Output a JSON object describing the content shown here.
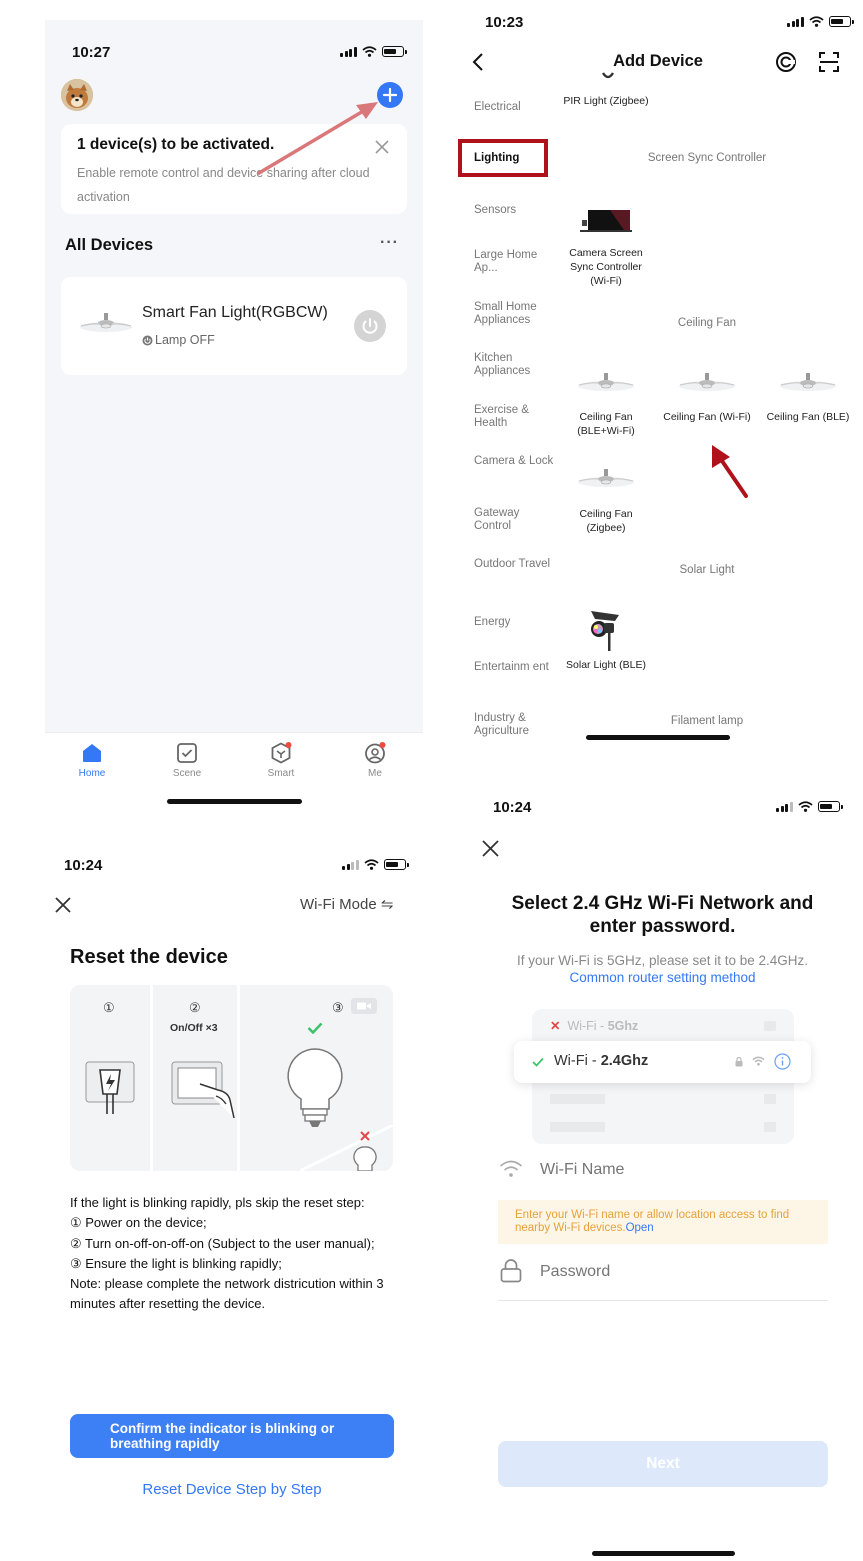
{
  "home": {
    "time": "10:27",
    "activation_title": "1 device(s) to be activated.",
    "activation_desc": "Enable remote control and device sharing after cloud activation",
    "all_devices": "All Devices",
    "more": "···",
    "device_name": "Smart Fan Light(RGBCW)",
    "device_status": "Lamp OFF",
    "tabs": [
      "Home",
      "Scene",
      "Smart",
      "Me"
    ]
  },
  "add_device": {
    "time": "10:23",
    "title": "Add Device",
    "categories": [
      "Electrical",
      "Lighting",
      "Sensors",
      "Large Home Ap...",
      "Small Home Appliances",
      "Kitchen Appliances",
      "Exercise & Health",
      "Camera & Lock",
      "Gateway Control",
      "Outdoor Travel",
      "Energy",
      "Entertainm ent",
      "Industry & Agriculture"
    ],
    "selected_category": "Lighting",
    "pir_light": "PIR Light (Zigbee)",
    "section_screen_sync": "Screen Sync Controller",
    "camera_sync": "Camera Screen Sync Controller (Wi-Fi)",
    "section_ceiling_fan": "Ceiling Fan",
    "fans": [
      "Ceiling Fan (BLE+Wi-Fi)",
      "Ceiling Fan (Wi-Fi)",
      "Ceiling Fan (BLE)",
      "Ceiling Fan (Zigbee)"
    ],
    "section_solar": "Solar Light",
    "solar_ble": "Solar Light (BLE)",
    "section_filament": "Filament lamp"
  },
  "reset": {
    "time": "10:24",
    "mode": "Wi-Fi Mode ⇋",
    "title": "Reset the device",
    "step_numbers": [
      "①",
      "②",
      "③"
    ],
    "step2_label": "On/Off ×3",
    "instructions": [
      "If the light is blinking rapidly, pls skip the reset step:",
      "① Power on the device;",
      "② Turn on-off-on-off-on (Subject to the user manual);",
      "③ Ensure the light is blinking rapidly;",
      "Note: please complete the network districution within 3 minutes after resetting the device."
    ],
    "confirm_button": "Confirm the indicator is blinking or breathing rapidly",
    "step_by_step": "Reset Device Step by Step"
  },
  "wifi": {
    "time": "10:24",
    "title": "Select 2.4 GHz Wi-Fi Network and enter password.",
    "desc": "If your Wi-Fi is 5GHz, please set it to be 2.4GHz.",
    "link": "Common router setting method",
    "wifi_5g_prefix": "Wi-Fi - ",
    "wifi_5g_band": "5Ghz",
    "wifi_24_prefix": "Wi-Fi - ",
    "wifi_24_band": "2.4Ghz",
    "name_placeholder": "Wi-Fi Name",
    "location_hint": "Enter your Wi-Fi name or allow location access to find nearby Wi-Fi devices.",
    "location_open": "Open",
    "password_placeholder": "Password",
    "next": "Next"
  },
  "colors": {
    "accent": "#3478f6",
    "red_highlight": "#b0121b",
    "arrow_pink": "#d9777a",
    "hint_bg": "#fdf5e6",
    "hint_text": "#e6a23c"
  }
}
